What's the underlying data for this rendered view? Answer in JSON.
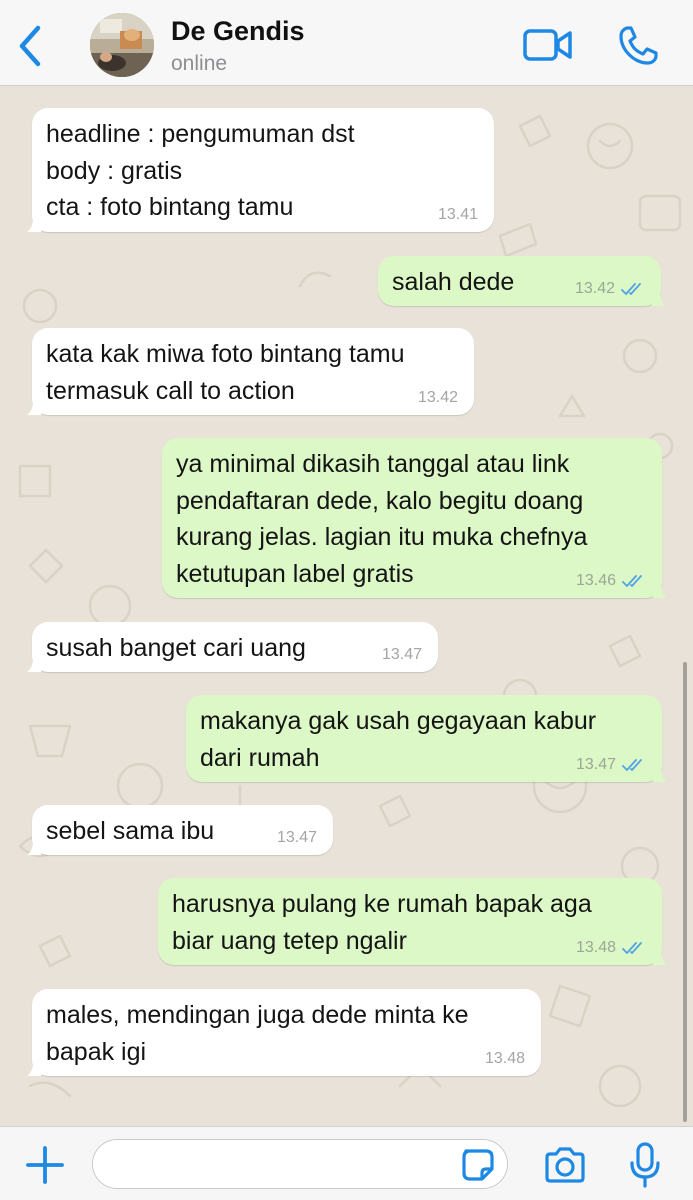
{
  "header": {
    "contact_name": "De Gendis",
    "status": "online",
    "icons": {
      "back": "chevron-left-icon",
      "video": "video-camera-icon",
      "call": "phone-icon"
    },
    "accent_color": "#1e88e5"
  },
  "messages": [
    {
      "direction": "in",
      "text": "headline : pengumuman dst\nbody : gratis\ncta : foto bintang tamu",
      "time": "13.41"
    },
    {
      "direction": "out",
      "text": "salah dede",
      "time": "13.42",
      "read": true
    },
    {
      "direction": "in",
      "text": "kata kak miwa foto bintang tamu\ntermasuk call to action",
      "time": "13.42"
    },
    {
      "direction": "out",
      "text": "ya minimal dikasih tanggal atau link\npendaftaran dede, kalo begitu doang\nkurang jelas. lagian itu muka chefnya\nketutupan label gratis",
      "time": "13.46",
      "read": true
    },
    {
      "direction": "in",
      "text": "susah banget cari uang",
      "time": "13.47"
    },
    {
      "direction": "out",
      "text": "makanya gak usah gegayaan kabur\ndari rumah",
      "time": "13.47",
      "read": true
    },
    {
      "direction": "in",
      "text": "sebel sama ibu",
      "time": "13.47"
    },
    {
      "direction": "out",
      "text": "harusnya pulang ke rumah bapak aga\nbiar uang tetep ngalir",
      "time": "13.48",
      "read": true
    },
    {
      "direction": "in",
      "text": "males, mendingan juga dede minta ke\nbapak igi",
      "time": "13.48"
    }
  ],
  "input_bar": {
    "placeholder": "",
    "value": "",
    "icons": {
      "attach": "plus-icon",
      "sticker": "sticker-icon",
      "camera": "camera-icon",
      "mic": "microphone-icon"
    }
  },
  "colors": {
    "outgoing_bubble": "#dcf8c6",
    "incoming_bubble": "#ffffff",
    "chat_background": "#e8e2d8",
    "read_tick": "#4fa3e6"
  }
}
